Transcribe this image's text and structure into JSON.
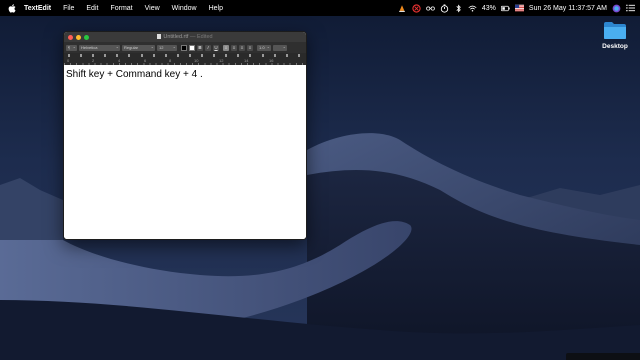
{
  "menubar": {
    "app_name": "TextEdit",
    "menus": [
      "File",
      "Edit",
      "Format",
      "View",
      "Window",
      "Help"
    ],
    "battery": "43%",
    "clock": "Sun 26 May  11:37:57 AM"
  },
  "desktop": {
    "folder_label": "Desktop"
  },
  "window": {
    "title": "Untitled.rtf",
    "title_suffix": " — Edited",
    "toolbar": {
      "paragraph_style": "¶",
      "font_family": "Helvetica",
      "font_style": "Regular",
      "font_size": "12",
      "bold": "B",
      "italic": "I",
      "underline": "U",
      "line_spacing": "1.0"
    },
    "ruler_numbers": [
      "0",
      "2",
      "4",
      "6",
      "8",
      "10",
      "12",
      "14",
      "16"
    ],
    "document_text": "Shift key + Command key + 4 ."
  },
  "colors": {
    "menubar_bg": "#000000",
    "close": "#ff5f57",
    "minimize": "#febc2e",
    "zoom": "#28c840",
    "folder_blue": "#3a9ee0"
  }
}
